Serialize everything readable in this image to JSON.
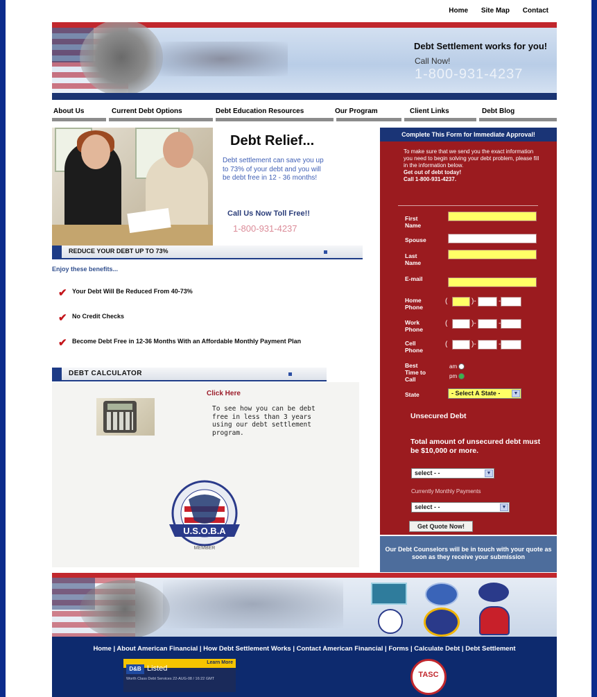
{
  "top_links": [
    "Home",
    "Site Map",
    "Contact"
  ],
  "header": {
    "tagline": "Debt Settlement works for you!",
    "call_now": "Call Now!",
    "phone": "1-800-931-4237"
  },
  "nav": [
    "About Us",
    "Current Debt Options",
    "Debt Education Resources",
    "Our Program",
    "Client Links",
    "Debt Blog"
  ],
  "hero": {
    "title": "Debt Relief...",
    "text": "Debt settlement can save you up to 73% of your debt and you will be debt free in 12 - 36 months!",
    "toll_free": "Call Us Now Toll Free!!",
    "toll_phone": "1-800-931-4237"
  },
  "reduce": {
    "header": "REDUCE YOUR DEBT UP TO 73%",
    "enjoy": "Enjoy these benefits...",
    "benefits": [
      "Your Debt Will Be Reduced From 40-73%",
      "No Credit Checks",
      "Become Debt Free in 12-36 Months With an Affordable Monthly Payment Plan"
    ]
  },
  "calculator": {
    "header": "DEBT CALCULATOR",
    "click_here": "Click Here",
    "text": "To see how you can be debt free in less than 3 years using our debt settlement program.",
    "badge_name": "U.S.O.B.A",
    "badge_sub": "MEMBER"
  },
  "form": {
    "title": "Complete This Form for Immediate Approval!",
    "intro": "To make sure that we send you the exact information you need to begin solving your debt problem, please fill in the information below.",
    "intro_bold1": "Get out of debt today!",
    "intro_bold2": "Call 1-800-931-4237.",
    "labels": {
      "first_name": "First Name",
      "spouse": "Spouse",
      "last_name": "Last Name",
      "email": "E-mail",
      "home_phone": "Home Phone",
      "work_phone": "Work Phone",
      "cell_phone": "Cell Phone",
      "best_time": "Best Time to Call",
      "state": "State"
    },
    "am": "am",
    "pm": "pm",
    "state_select": "- Select A State -",
    "unsecured_heading": "Unsecured Debt",
    "total_text": "Total amount of unsecured debt must be $10,000 or more.",
    "select1": "select - -",
    "monthly_label": "Currently Monthly Payments",
    "select2": "select - -",
    "submit": "Get Quote Now!",
    "footer_text": "Our Debt Counselors will be in touch with your quote as soon as they receive your submission"
  },
  "footer": {
    "links": "Home | About American Financial | How Debt Settlement Works | Contact American Financial | Forms | Calculate Debt | Debt Settlement",
    "dnb_logo": "D&B",
    "dnb_listed": "Listed",
    "dnb_learn": "Learn More",
    "dnb_small": "Worth Class Debt Services 22-AUG-08 / 16:22 GMT",
    "tasc": "TASC"
  },
  "colors": {
    "page_bg": "#0c2c8c",
    "form_red": "#9b1b1f",
    "navy": "#1a3476",
    "yellow_field": "#ffff66",
    "check_red": "#c4161c"
  }
}
